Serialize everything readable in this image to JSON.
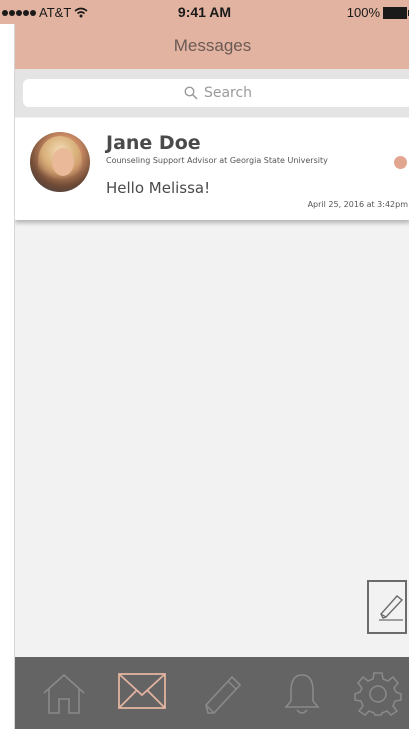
{
  "status_bar": {
    "carrier": "AT&T",
    "time": "9:41 AM",
    "battery": "100%"
  },
  "header": {
    "title": "Messages"
  },
  "search": {
    "placeholder": "Search"
  },
  "messages": [
    {
      "name": "Jane Doe",
      "role": "Counseling Support Advisor at Georgia State University",
      "preview": "Hello Melissa!",
      "timestamp": "April 25, 2016 at 3:42pm",
      "unread": true
    }
  ],
  "tab_bar": {
    "items": [
      {
        "icon": "home-icon",
        "active": false
      },
      {
        "icon": "mail-icon",
        "active": true
      },
      {
        "icon": "pencil-icon",
        "active": false
      },
      {
        "icon": "bell-icon",
        "active": false
      },
      {
        "icon": "gear-icon",
        "active": false
      }
    ]
  },
  "colors": {
    "accent": "#e2b3a0",
    "unread_dot": "#e2a690",
    "tab_bar_bg": "#646464",
    "tab_icon": "#8a8a8a",
    "tab_icon_active": "#e2b3a0"
  }
}
